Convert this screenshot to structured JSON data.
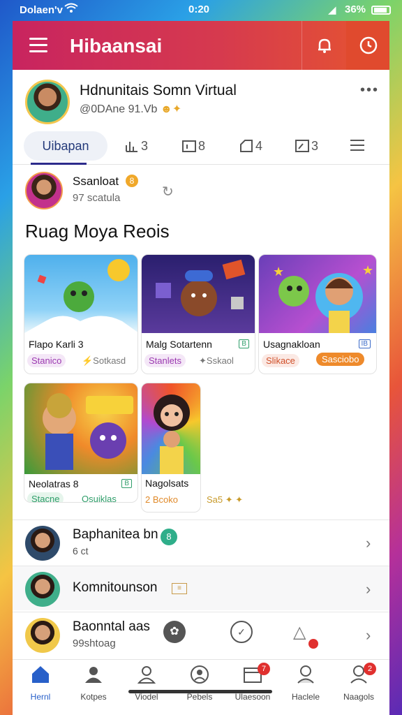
{
  "status_bar": {
    "carrier": "Dolaen'v",
    "time": "0:20",
    "battery": "36%"
  },
  "appbar": {
    "title": "Hibaansai"
  },
  "profile": {
    "name": "Hdnunitais Somn Virtual",
    "subtitle": "@0DAne 91.Vb",
    "more": "•••"
  },
  "tabs": {
    "active": "Uibapan",
    "items": [
      {
        "icon": "chart-icon",
        "count": "3"
      },
      {
        "icon": "calendar-icon",
        "count": "8"
      },
      {
        "icon": "tag-icon",
        "count": "4"
      },
      {
        "icon": "image-icon",
        "count": "3"
      }
    ]
  },
  "author": {
    "name": "Ssanloat",
    "badge": "8",
    "sub": "97 scatula"
  },
  "section": {
    "title": "Ruag Moya Reois"
  },
  "cards": [
    {
      "name": "Flapo Karli 3",
      "chip": "Stanico",
      "meta": "⚡Sotkasd"
    },
    {
      "name": "Malg Sotartenn",
      "badge": "B",
      "chip": "Stanlets",
      "meta": "✦Sskaol"
    },
    {
      "name": "Usagnakloan",
      "badge": "IB",
      "chip": "Slikace",
      "cta": "Sasciobo"
    },
    {
      "name": "Neolatras 8",
      "badge": "B",
      "chip": "Stacne",
      "meta": "Osuiklas"
    },
    {
      "name": "Nagolsats",
      "chip": "2 Bcoko",
      "meta": "Sa5 ✦ ✦"
    }
  ],
  "list_rows": [
    {
      "title": "Baphanitea bn",
      "sub": "6 ct",
      "badge": "8"
    },
    {
      "title": "Komnitounson",
      "sub": ""
    },
    {
      "title": "Baonntal aas",
      "sub": "99shtoag"
    }
  ],
  "bottom_nav": [
    {
      "label": "Hernl",
      "icon": "home-icon",
      "active": true
    },
    {
      "label": "Kotpes",
      "icon": "people-icon"
    },
    {
      "label": "Viodel",
      "icon": "user-icon"
    },
    {
      "label": "Pebels",
      "icon": "profile-circle-icon"
    },
    {
      "label": "Ulaesoon",
      "icon": "inbox-icon",
      "badge": "7"
    },
    {
      "label": "Haclele",
      "icon": "person-icon"
    },
    {
      "label": "Naagols",
      "icon": "account-icon",
      "badge": "2"
    }
  ]
}
